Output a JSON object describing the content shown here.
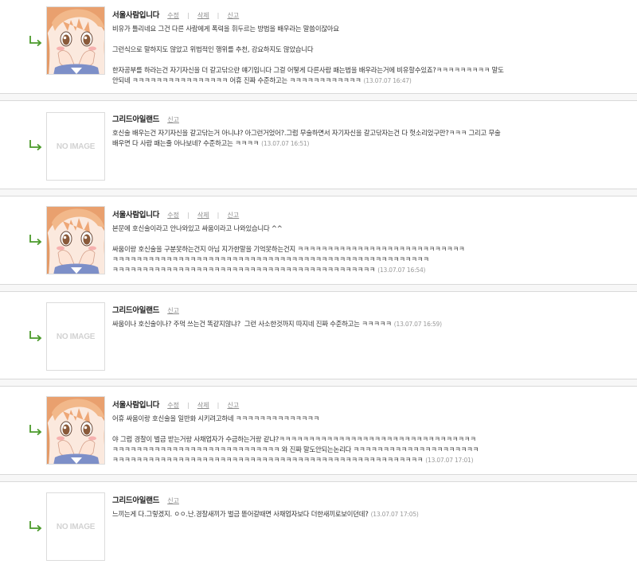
{
  "colors": {
    "arrow": "#4a9a2a",
    "separator_bg": "#f7f7f7",
    "separator_border": "#d9d9d9"
  },
  "icons": {
    "reply": "reply-arrow-icon",
    "avatar_anime": "anime-girl-avatar",
    "no_image": "no-image-placeholder"
  },
  "no_image_label": "NO IMAGE",
  "actions": {
    "edit": "수정",
    "delete": "삭제",
    "report": "신고",
    "sep": "|"
  },
  "comments": [
    {
      "nickname": "서울사람입니다",
      "has_avatar": true,
      "lines": [
        "비유가 틀리네요 그건 다른 사람에게 폭력을 휘두르는 방법을 배우라는 말씀이잖아요",
        "",
        "그런식으로 말하지도 않았고 위법적인 행위를 추천, 강요하지도 않았습니다",
        "",
        "한자공부를 하라는건 자기자신을 더 갈고닦으란 얘기입니다 그걸 어떻게 다른사람 패는법을 배우라는거에 비유할수있죠?ㅋㅋㅋㅋㅋㅋㅋㅋㅋ 말도",
        "안되네 ㅋㅋㅋㅋㅋㅋㅋㅋㅋㅋㅋㅋㅋㅋㅋㅋ 어휴 진짜 수준하고는 ㅋㅋㅋㅋㅋㅋㅋㅋㅋㅋㅋㅋ"
      ],
      "date": "(13.07.07 16:47)"
    },
    {
      "nickname": "그리드아일랜드",
      "has_avatar": false,
      "lines": [
        "호신술 배우는건 자기자신을 갈고닦는거 아니냐? 아그런거었어?.그럼 무술하면서 자기자신을 갈고닦자는건 다 헛소리었구만?ㅋㅋㅋ 그리고 무술",
        "배우면 다 사람 패는줄 아나보네? 수준하고는 ㅋㅋㅋㅋ"
      ],
      "date": "(13.07.07 16:51)"
    },
    {
      "nickname": "서울사람입니다",
      "has_avatar": true,
      "lines": [
        "본문에 호신술이라고 안나와있고 싸움이라고 나와있습니다 ^^",
        "",
        "싸움이랑 호신술을 구분못하는건지 아님 지가한말을 기억못하는건지 ㅋㅋㅋㅋㅋㅋㅋㅋㅋㅋㅋㅋㅋㅋㅋㅋㅋㅋㅋㅋㅋㅋㅋㅋㅋㅋㅋㅋ",
        "ㅋㅋㅋㅋㅋㅋㅋㅋㅋㅋㅋㅋㅋㅋㅋㅋㅋㅋㅋㅋㅋㅋㅋㅋㅋㅋㅋㅋㅋㅋㅋㅋㅋㅋㅋㅋㅋㅋㅋㅋㅋㅋㅋㅋㅋㅋㅋㅋㅋㅋㅋㅋㅋ",
        "ㅋㅋㅋㅋㅋㅋㅋㅋㅋㅋㅋㅋㅋㅋㅋㅋㅋㅋㅋㅋㅋㅋㅋㅋㅋㅋㅋㅋㅋㅋㅋㅋㅋㅋㅋㅋㅋㅋㅋㅋㅋㅋㅋㅋ"
      ],
      "date": "(13.07.07 16:54)"
    },
    {
      "nickname": "그리드아일랜드",
      "has_avatar": false,
      "lines": [
        "싸움이나 호신술이나? 주먹 쓰는건 똑같지않냐?  그런 사소한것까지 따지네 진짜 수준하고는 ㅋㅋㅋㅋㅋ"
      ],
      "date": "(13.07.07 16:59)"
    },
    {
      "nickname": "서울사람입니다",
      "has_avatar": true,
      "lines": [
        "어휴 싸움이랑 호신술을 일반화 시키려고하네 ㅋㅋㅋㅋㅋㅋㅋㅋㅋㅋㅋㅋㅋㅋ",
        "",
        "야 그럼 경찰이 벌금 받는거랑 사채업자가 수금하는거랑 같냐?ㅋㅋㅋㅋㅋㅋㅋㅋㅋㅋㅋㅋㅋㅋㅋㅋㅋㅋㅋㅋㅋㅋㅋㅋㅋㅋㅋㅋㅋㅋㅋㅋㅋ",
        "ㅋㅋㅋㅋㅋㅋㅋㅋㅋㅋㅋㅋㅋㅋㅋㅋㅋㅋㅋㅋㅋㅋㅋㅋㅋㅋㅋㅋ 와 진짜 말도안되는논리다 ㅋㅋㅋㅋㅋㅋㅋㅋㅋㅋㅋㅋㅋㅋㅋㅋㅋㅋㅋㅋㅋ",
        "ㅋㅋㅋㅋㅋㅋㅋㅋㅋㅋㅋㅋㅋㅋㅋㅋㅋㅋㅋㅋㅋㅋㅋㅋㅋㅋㅋㅋㅋㅋㅋㅋㅋㅋㅋㅋㅋㅋㅋㅋㅋㅋㅋㅋㅋㅋㅋㅋㅋㅋㅋㅋ"
      ],
      "date": "(13.07.07 17:01)"
    },
    {
      "nickname": "그리드아일랜드",
      "has_avatar": false,
      "lines": [
        "느끼는게 다.그렇겠지. ㅇㅇ.난.경찰새끼가 벌금 뜯어갈때면 사채업자보다 더한새끼로보이던데?"
      ],
      "date": "(13.07.07 17:05)"
    }
  ]
}
